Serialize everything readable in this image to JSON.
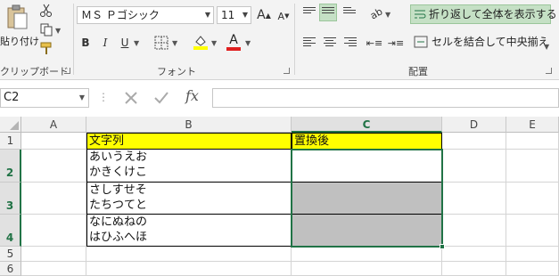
{
  "ribbon": {
    "clipboard": {
      "paste_label": "貼り付け",
      "group_label": "クリップボード"
    },
    "font": {
      "name": "ＭＳ Ｐゴシック",
      "size": "11",
      "bold": "B",
      "italic": "I",
      "underline": "U",
      "group_label": "フォント"
    },
    "alignment": {
      "wrap_text_label": "折り返して全体を表示する",
      "merge_center_label": "セルを結合して中央揃え",
      "group_label": "配置"
    }
  },
  "formula_bar": {
    "name_box": "C2",
    "fx": "fx",
    "formula": ""
  },
  "colors": {
    "yellow_fill": "#ffff00",
    "gray_fill": "#c0c0c0",
    "font_color": "#e02020",
    "selection": "#217346"
  },
  "columns": [
    "A",
    "B",
    "C",
    "D",
    "E"
  ],
  "rows": [
    "1",
    "2",
    "3",
    "4",
    "5",
    "6"
  ],
  "cells": {
    "B1": "文字列",
    "C1": "置換後",
    "B2_line1": "あいうえお",
    "B2_line2": "かきくけこ",
    "B3_line1": "さしすせそ",
    "B3_line2": "たちつてと",
    "B4_line1": "なにぬねの",
    "B4_line2": "はひふへほ"
  },
  "active_cell": "C2",
  "selection_range": "C2:C4"
}
